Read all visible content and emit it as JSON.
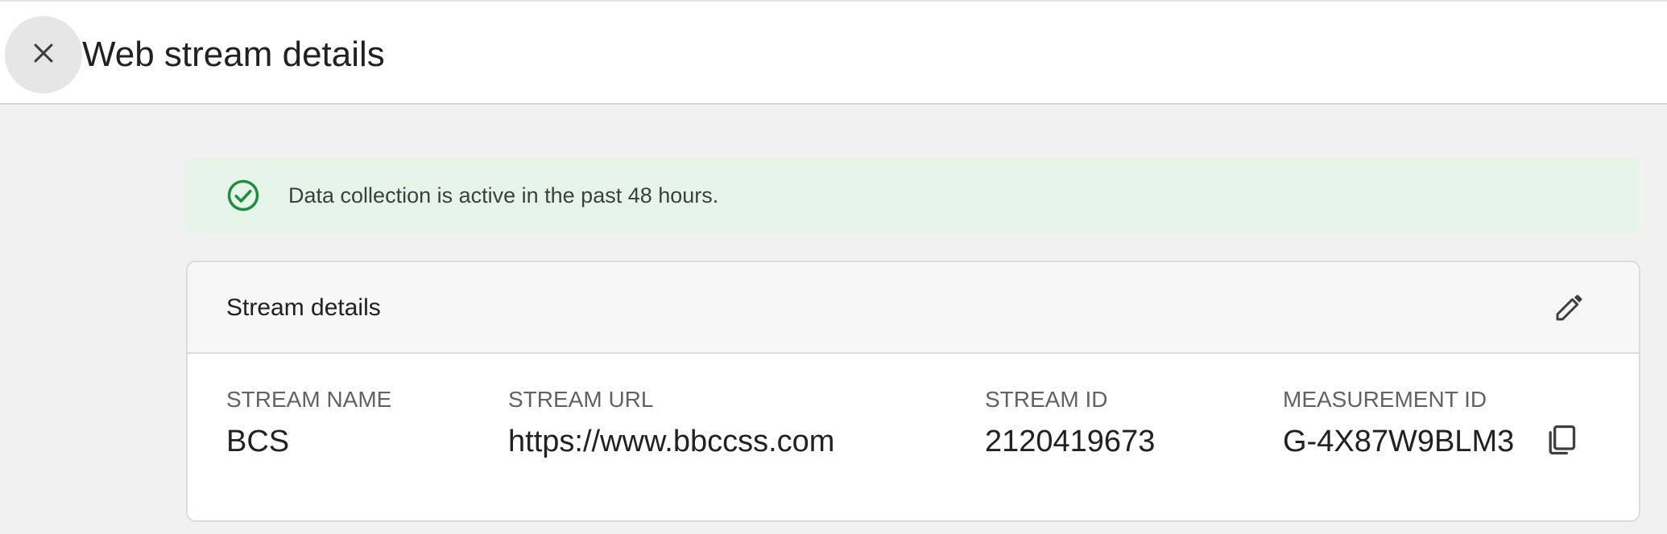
{
  "header": {
    "title": "Web stream details",
    "close_icon": "close-icon"
  },
  "banner": {
    "text": "Data collection is active in the past 48 hours.",
    "icon": "check-circle-icon",
    "color": "#1e8e3e",
    "background": "#e6f4ea"
  },
  "card": {
    "title": "Stream details",
    "edit_icon": "pencil-icon",
    "fields": [
      {
        "label": "STREAM NAME",
        "value": "BCS"
      },
      {
        "label": "STREAM URL",
        "value": "https://www.bbccss.com"
      },
      {
        "label": "STREAM ID",
        "value": "2120419673"
      },
      {
        "label": "MEASUREMENT ID",
        "value": "G-4X87W9BLM3"
      }
    ],
    "copy_icon": "copy-icon"
  }
}
